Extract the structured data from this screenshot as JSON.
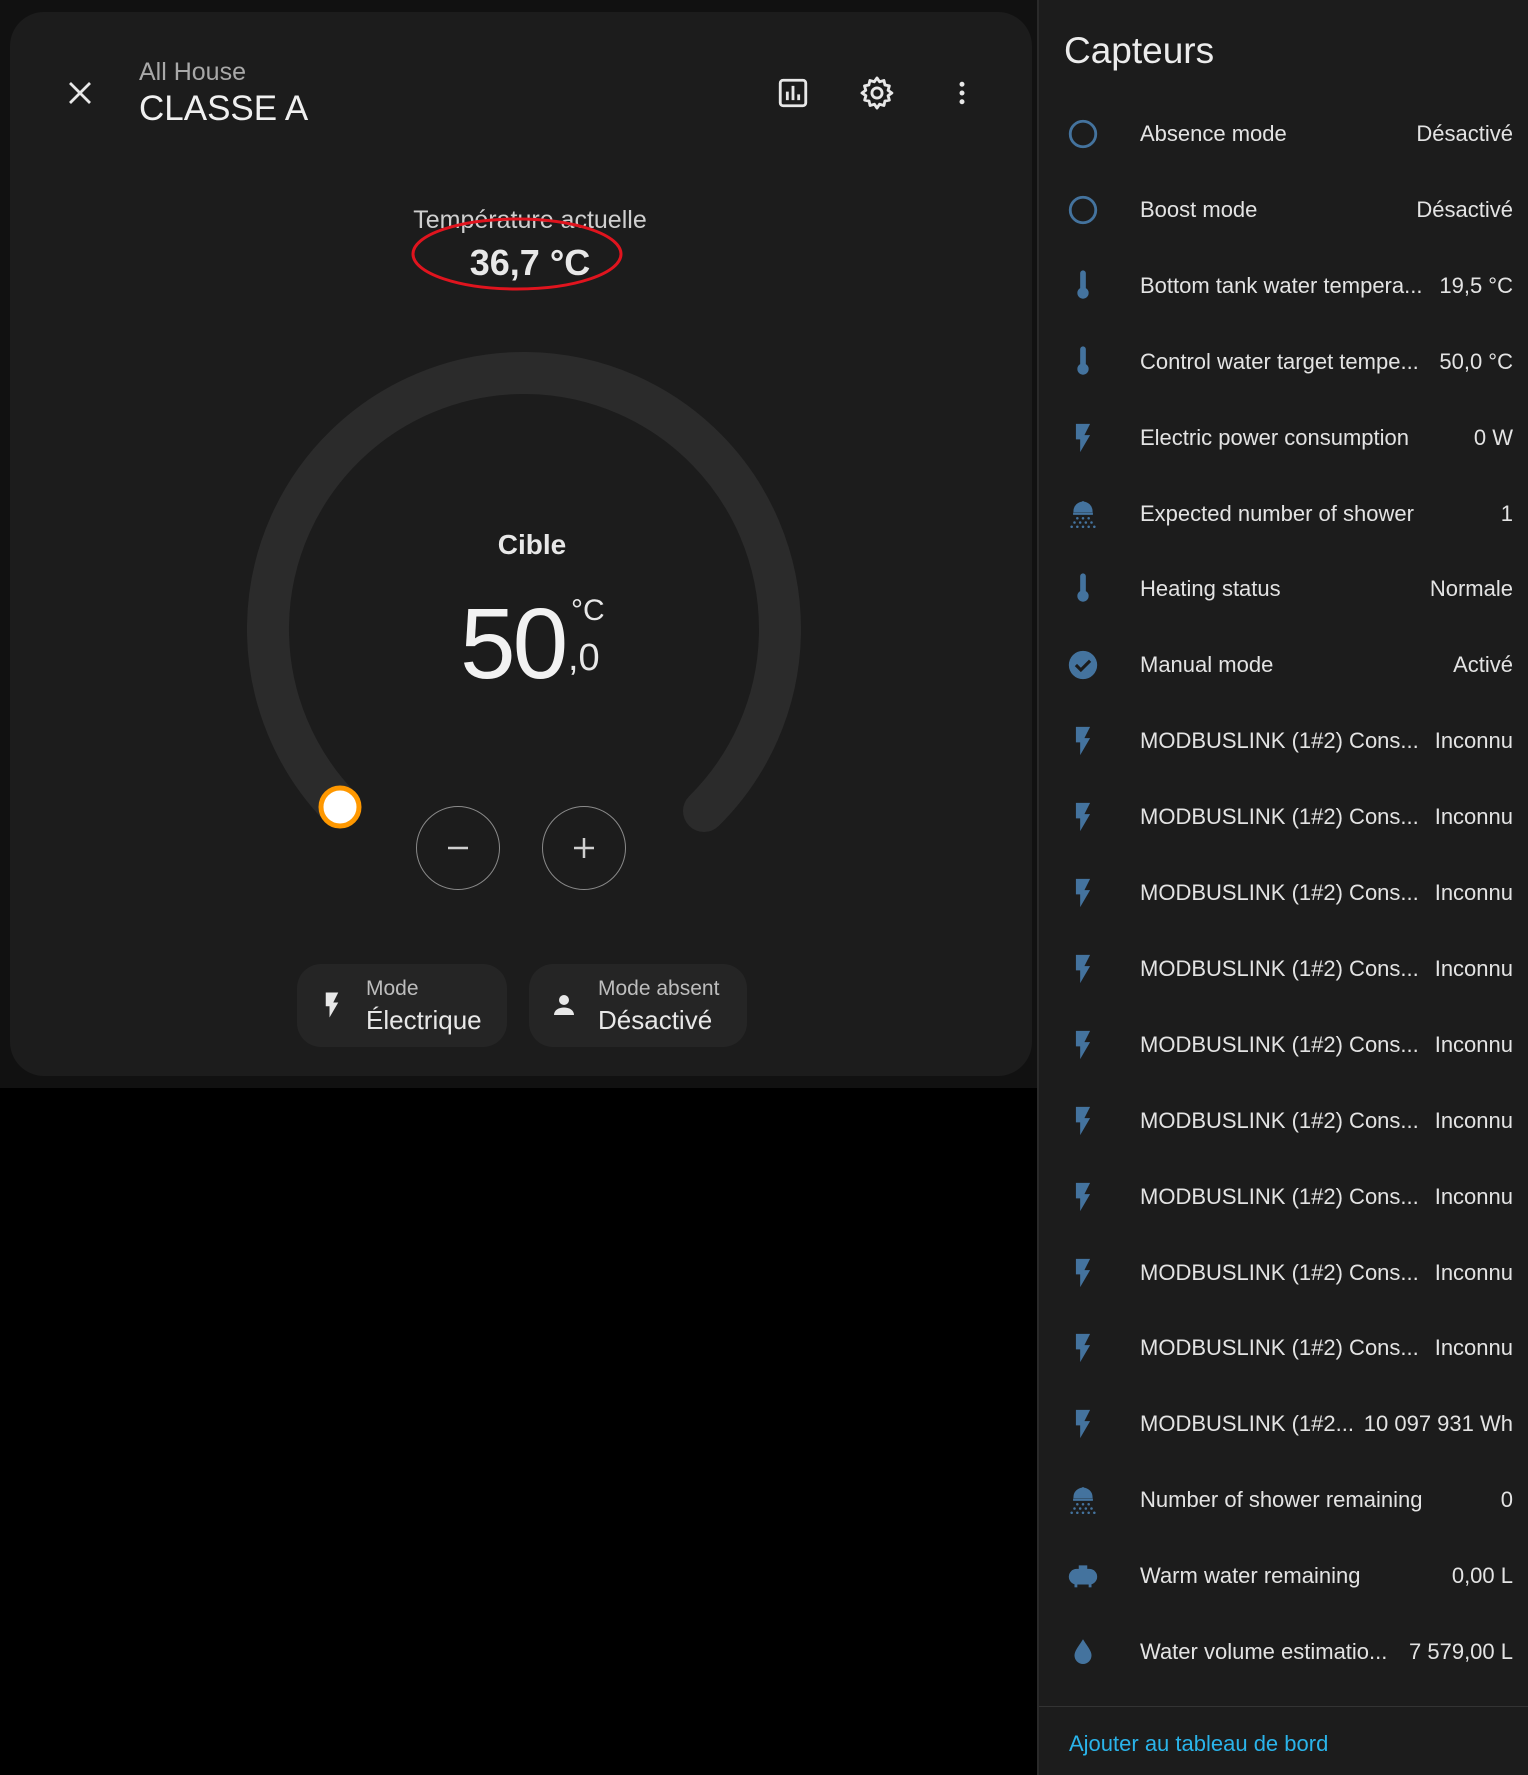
{
  "dialog": {
    "subtitle": "All House",
    "title": "CLASSE A",
    "current_label": "Température actuelle",
    "current_value": "36,7 °C",
    "target_label": "Cible",
    "target_int": "50",
    "target_unit": "°C",
    "target_dec": ",0",
    "modes": [
      {
        "label": "Mode",
        "value": "Électrique",
        "icon": "flash-icon"
      },
      {
        "label": "Mode absent",
        "value": "Désactivé",
        "icon": "account-icon"
      }
    ],
    "colors": {
      "handle": "#ff9800",
      "annotation": "#e0141e",
      "track": "#2b2b2b"
    }
  },
  "panel": {
    "title": "Capteurs",
    "items": [
      {
        "icon": "circle-outline",
        "label": "Absence mode",
        "value": "Désactivé"
      },
      {
        "icon": "circle-outline",
        "label": "Boost mode",
        "value": "Désactivé"
      },
      {
        "icon": "thermometer",
        "label": "Bottom tank water tempera...",
        "value": "19,5 °C"
      },
      {
        "icon": "thermometer",
        "label": "Control water target tempe...",
        "value": "50,0 °C"
      },
      {
        "icon": "flash",
        "label": "Electric power consumption",
        "value": "0 W"
      },
      {
        "icon": "shower",
        "label": "Expected number of shower",
        "value": "1"
      },
      {
        "icon": "thermometer",
        "label": "Heating status",
        "value": "Normale"
      },
      {
        "icon": "check-circle",
        "label": "Manual mode",
        "value": "Activé"
      },
      {
        "icon": "flash",
        "label": "MODBUSLINK (1#2) Cons...",
        "value": "Inconnu"
      },
      {
        "icon": "flash",
        "label": "MODBUSLINK (1#2) Cons...",
        "value": "Inconnu"
      },
      {
        "icon": "flash",
        "label": "MODBUSLINK (1#2) Cons...",
        "value": "Inconnu"
      },
      {
        "icon": "flash",
        "label": "MODBUSLINK (1#2) Cons...",
        "value": "Inconnu"
      },
      {
        "icon": "flash",
        "label": "MODBUSLINK (1#2) Cons...",
        "value": "Inconnu"
      },
      {
        "icon": "flash",
        "label": "MODBUSLINK (1#2) Cons...",
        "value": "Inconnu"
      },
      {
        "icon": "flash",
        "label": "MODBUSLINK (1#2) Cons...",
        "value": "Inconnu"
      },
      {
        "icon": "flash",
        "label": "MODBUSLINK (1#2) Cons...",
        "value": "Inconnu"
      },
      {
        "icon": "flash",
        "label": "MODBUSLINK (1#2) Cons...",
        "value": "Inconnu"
      },
      {
        "icon": "flash",
        "label": "MODBUSLINK (1#2...",
        "value": "10 097 931 Wh"
      },
      {
        "icon": "shower",
        "label": "Number of shower remaining",
        "value": "0"
      },
      {
        "icon": "water-boiler",
        "label": "Warm water remaining",
        "value": "0,00 L"
      },
      {
        "icon": "water-drop",
        "label": "Water volume estimatio...",
        "value": "7 579,00 L"
      }
    ],
    "add_link": "Ajouter au tableau de bord",
    "colors": {
      "icon": "#44739e",
      "link": "#2ab4ea"
    }
  }
}
